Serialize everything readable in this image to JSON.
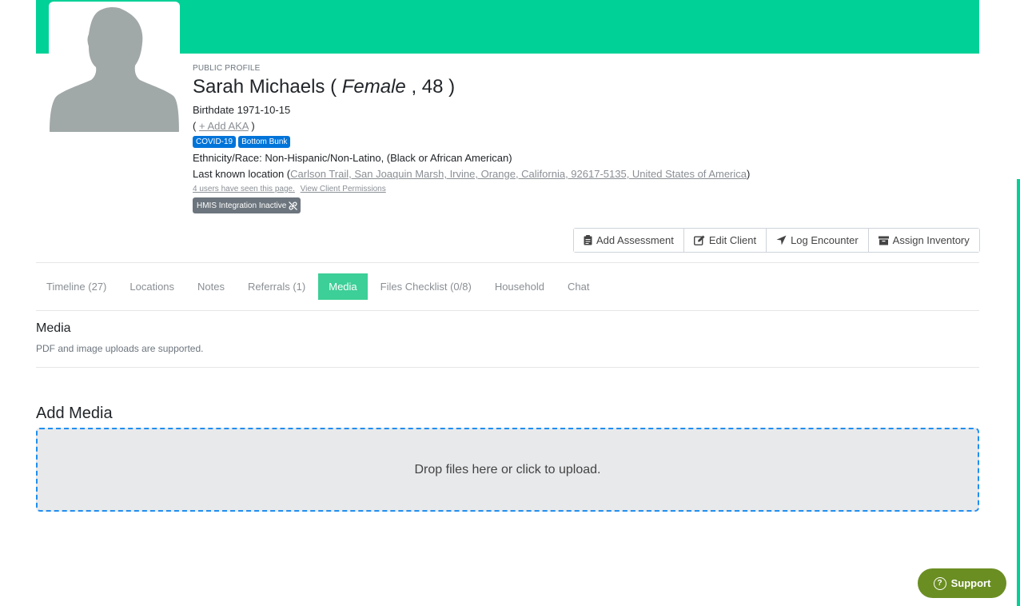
{
  "profile": {
    "public_label": "PUBLIC PROFILE",
    "name": "Sarah Michaels",
    "gender": "Female",
    "age": "48",
    "birthdate_label": "Birthdate",
    "birthdate": "1971-10-15",
    "add_aka": "+ Add AKA",
    "badges": [
      "COVID-19",
      "Bottom Bunk"
    ],
    "ethnicity_label": "Ethnicity/Race:",
    "ethnicity": "Non-Hispanic/Non-Latino, (Black or African American)",
    "location_label": "Last known location",
    "location": "Carlson Trail, San Joaquin Marsh, Irvine, Orange, California, 92617-5135, United States of America",
    "seen_text": "4 users have seen this page.",
    "permissions_text": "View Client Permissions",
    "hmis_label": "HMIS Integration Inactive"
  },
  "actions": {
    "add_assessment": "Add Assessment",
    "edit_client": "Edit Client",
    "log_encounter": "Log Encounter",
    "assign_inventory": "Assign Inventory"
  },
  "tabs": [
    {
      "label": "Timeline (27)",
      "active": false
    },
    {
      "label": "Locations",
      "active": false
    },
    {
      "label": "Notes",
      "active": false
    },
    {
      "label": "Referrals (1)",
      "active": false
    },
    {
      "label": "Media",
      "active": true
    },
    {
      "label": "Files Checklist (0/8)",
      "active": false
    },
    {
      "label": "Household",
      "active": false
    },
    {
      "label": "Chat",
      "active": false
    }
  ],
  "media": {
    "title": "Media",
    "description": "PDF and image uploads are supported.",
    "add_title": "Add Media",
    "dropzone_text": "Drop files here or click to upload."
  },
  "support": {
    "label": "Support"
  },
  "colors": {
    "brand": "#00d197",
    "tab_active": "#3ccf97",
    "badge": "#0074d9",
    "support": "#6b8e23"
  }
}
